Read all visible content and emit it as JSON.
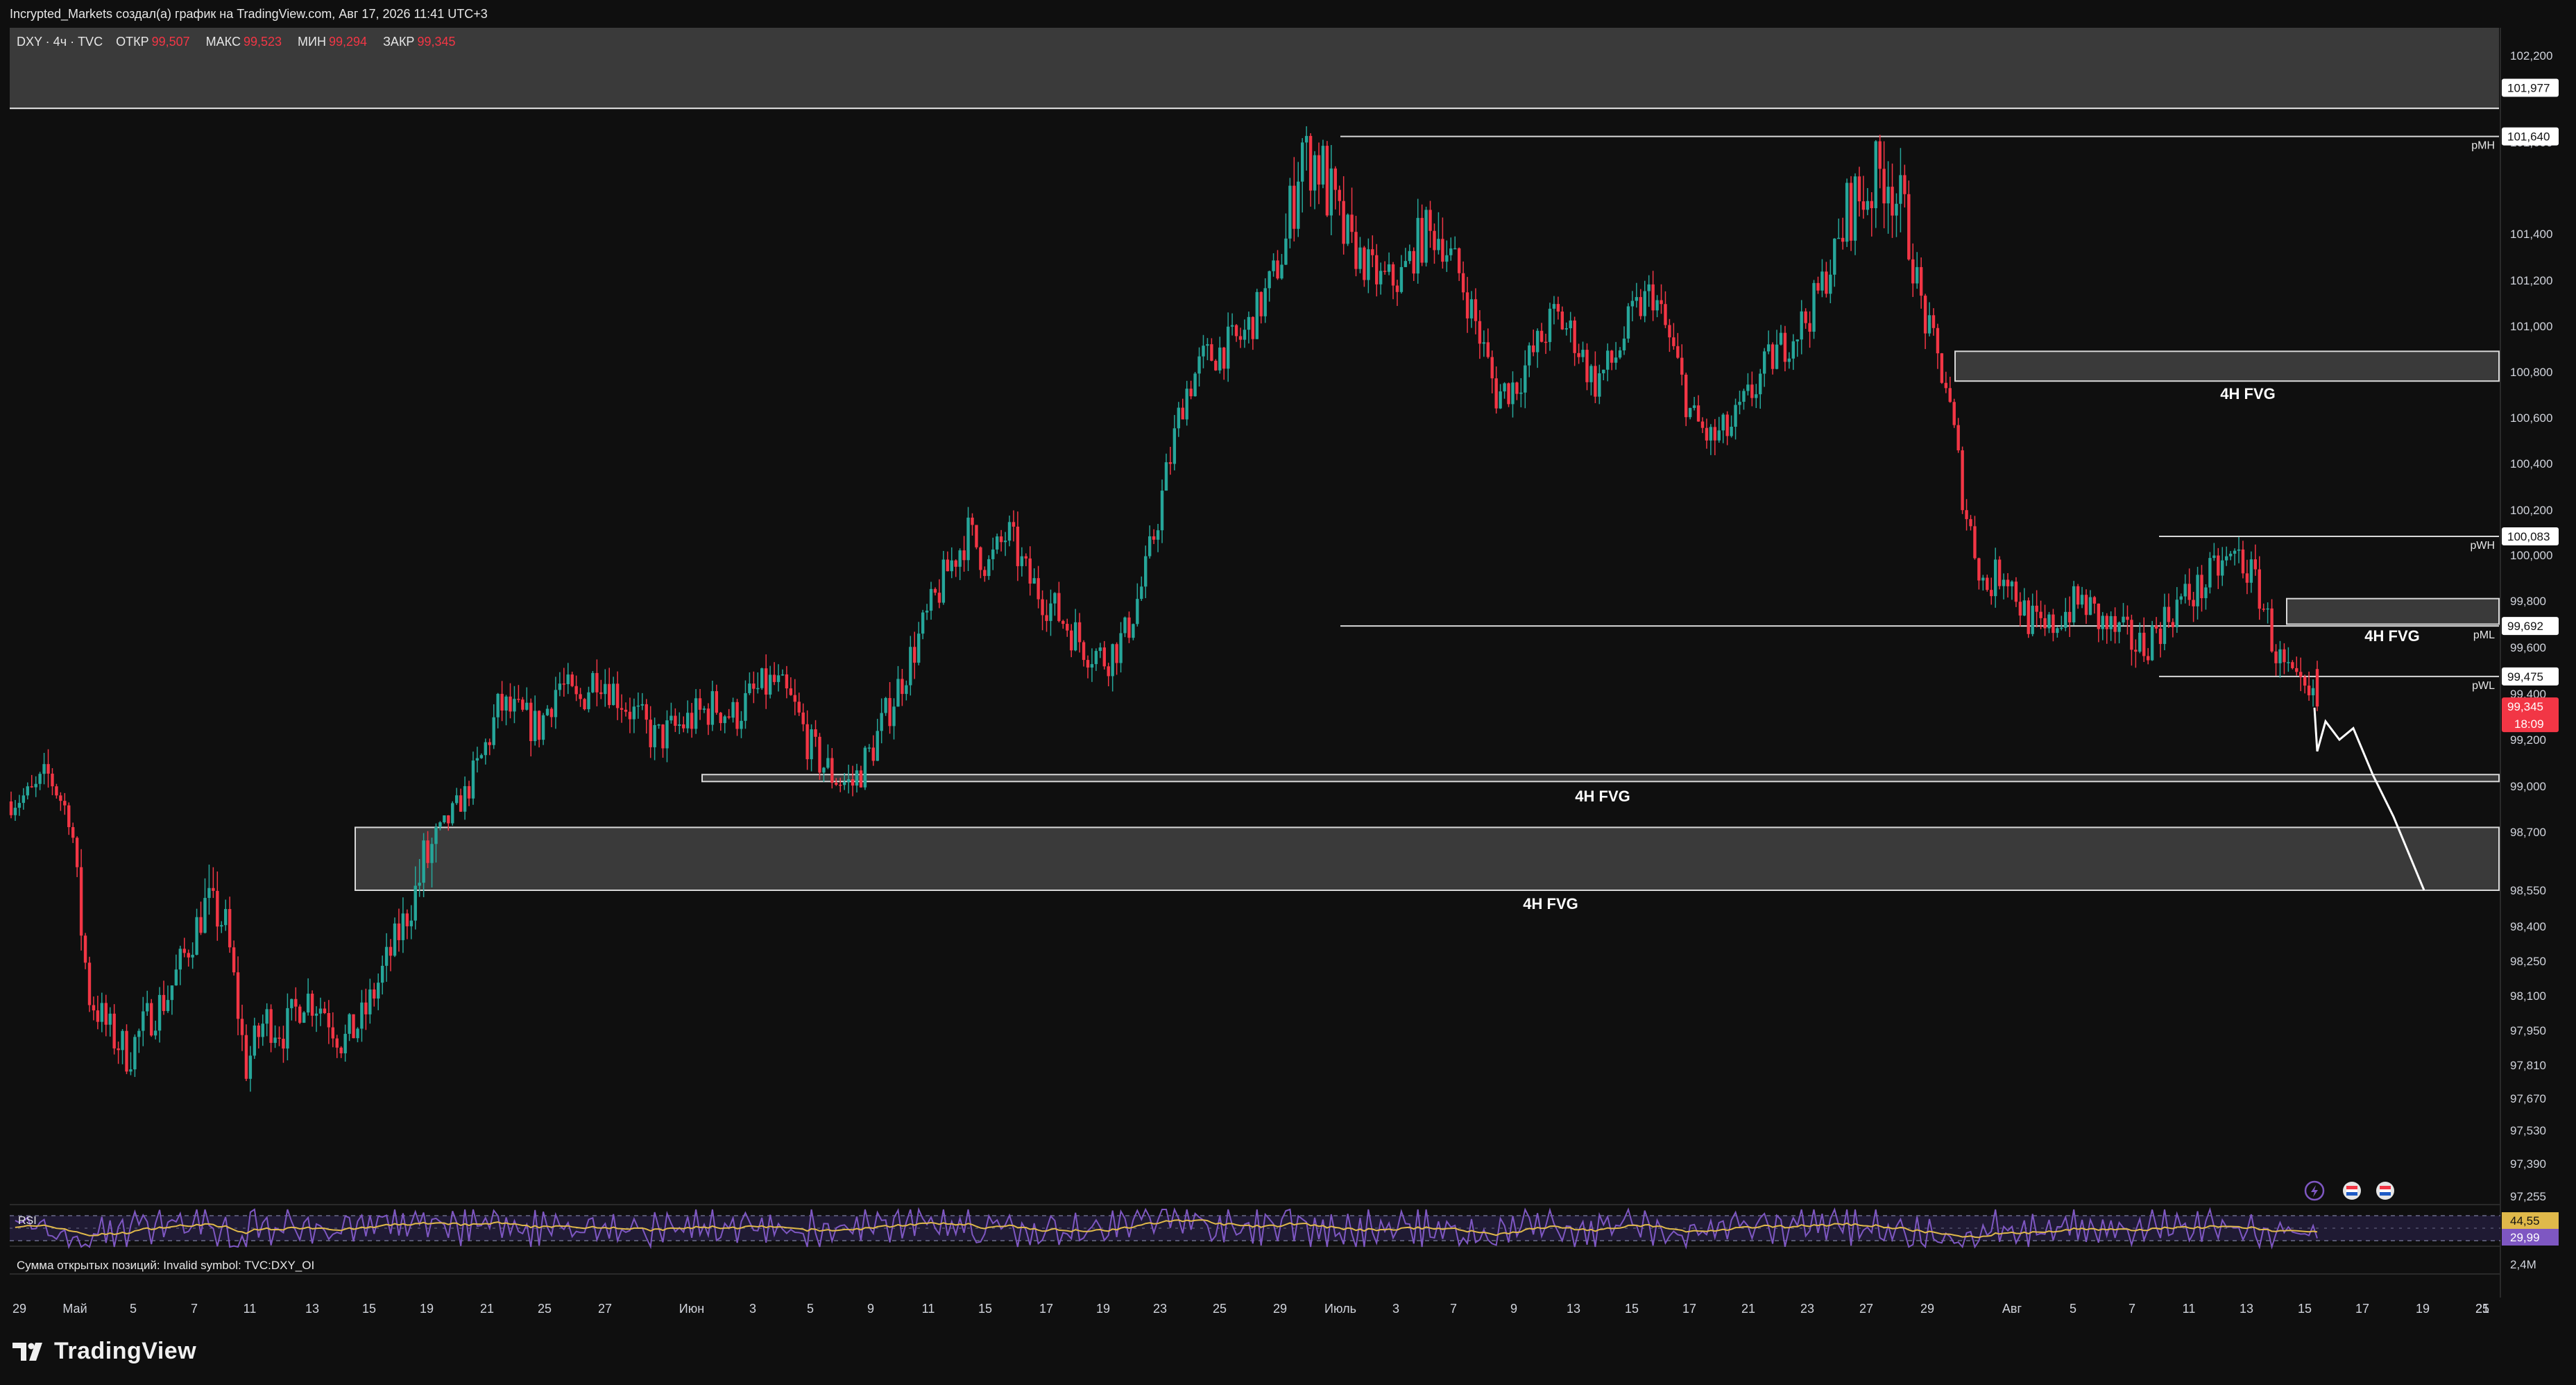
{
  "header": {
    "author_line": "Incrypted_Markets создал(а) график на TradingView.com, Авг 17, 2026 11:41 UTC+3"
  },
  "legend": {
    "symbol": "DXY · 4ч · TVC",
    "open_label": "ОТКР",
    "open_value": "99,507",
    "high_label": "МАКС",
    "high_value": "99,523",
    "low_label": "МИН",
    "low_value": "99,294",
    "close_label": "ЗАКР",
    "close_value": "99,345"
  },
  "colors": {
    "background": "#0f0f0f",
    "up_candle": "#26a69a",
    "down_candle": "#f23645",
    "zone_fill": "#3a3a3a",
    "level_line": "#d9d9d9",
    "projection": "#ffffff",
    "rsi_line": "#7e57c2",
    "rsi_ma": "#e0b94a"
  },
  "price_axis": {
    "ticks": [
      "102,200",
      "101,600",
      "101,400",
      "101,200",
      "101,000",
      "100,800",
      "100,600",
      "100,400",
      "100,200",
      "100,000",
      "99,800",
      "99,600",
      "99,400",
      "99,200",
      "99,000",
      "98,700",
      "98,550",
      "98,400",
      "98,250",
      "98,100",
      "97,950",
      "97,810",
      "97,670",
      "97,530",
      "97,390",
      "97,255"
    ],
    "tick_values": [
      102.2,
      101.6,
      101.4,
      101.2,
      101.0,
      100.8,
      100.6,
      100.4,
      100.2,
      100.0,
      99.8,
      99.6,
      99.4,
      99.2,
      99.0,
      98.7,
      98.55,
      98.4,
      98.25,
      98.1,
      97.95,
      97.81,
      97.67,
      97.53,
      97.39,
      97.255
    ],
    "price_labels": [
      {
        "text": "101,977",
        "value": 101.977,
        "style": "white"
      },
      {
        "text": "101,640",
        "value": 101.64,
        "style": "white"
      },
      {
        "text": "100,083",
        "value": 100.083,
        "style": "white"
      },
      {
        "text": "99,692",
        "value": 99.692,
        "style": "white"
      },
      {
        "text": "99,475",
        "value": 99.475,
        "style": "white"
      },
      {
        "text": "99,345",
        "value": 99.345,
        "style": "red"
      }
    ],
    "countdown": "18:09"
  },
  "time_axis": {
    "labels": [
      "29",
      "Май",
      "5",
      "7",
      "11",
      "13",
      "15",
      "19",
      "21",
      "25",
      "27",
      "Июн",
      "3",
      "5",
      "9",
      "11",
      "15",
      "17",
      "19",
      "23",
      "25",
      "29",
      "Июль",
      "3",
      "7",
      "9",
      "13",
      "15",
      "17",
      "21",
      "23",
      "27",
      "29",
      "Авг",
      "5",
      "7",
      "11",
      "13",
      "15",
      "17",
      "19",
      "21",
      "25"
    ]
  },
  "levels": [
    {
      "text": "pMH",
      "value": 101.64
    },
    {
      "text": "pWH",
      "value": 100.083
    },
    {
      "text": "pML",
      "value": 99.692
    },
    {
      "text": "pWL",
      "value": 99.475
    }
  ],
  "fvg_zones": [
    {
      "label": "4H FVG",
      "top": 100.89,
      "bottom": 100.76
    },
    {
      "label": "4H FVG",
      "top": 99.81,
      "bottom": 99.7
    },
    {
      "label": "4H FVG",
      "top": 99.05,
      "bottom": 99.02
    },
    {
      "label": "4H FVG",
      "top": 98.73,
      "bottom": 98.55
    }
  ],
  "chart_data": {
    "type": "candlestick",
    "symbol": "DXY",
    "timeframe": "4ч",
    "ylim": [
      97.255,
      102.2
    ],
    "x_range_labels": [
      "29",
      "25"
    ],
    "path_closes": [
      98.9,
      98.95,
      99.05,
      98.8,
      98.1,
      97.95,
      97.85,
      98.0,
      98.1,
      98.3,
      98.5,
      98.4,
      97.8,
      98.0,
      97.95,
      98.1,
      98.05,
      97.9,
      98.0,
      98.2,
      98.4,
      98.6,
      98.7,
      98.9,
      99.1,
      99.35,
      99.3,
      99.25,
      99.45,
      99.35,
      99.5,
      99.4,
      99.3,
      99.2,
      99.25,
      99.3,
      99.35,
      99.3,
      99.4,
      99.45,
      99.35,
      99.15,
      99.05,
      99.0,
      99.15,
      99.35,
      99.55,
      99.75,
      99.95,
      100.1,
      99.95,
      100.1,
      99.9,
      99.8,
      99.7,
      99.6,
      99.55,
      99.65,
      99.9,
      100.3,
      100.7,
      100.85,
      100.9,
      100.95,
      101.1,
      101.3,
      101.6,
      101.55,
      101.4,
      101.3,
      101.2,
      101.2,
      101.35,
      101.4,
      101.25,
      101.0,
      100.7,
      100.75,
      100.9,
      101.05,
      100.95,
      100.75,
      100.85,
      101.05,
      101.15,
      100.9,
      100.6,
      100.5,
      100.55,
      100.7,
      100.85,
      100.95,
      101.05,
      101.25,
      101.45,
      101.5,
      101.55,
      101.4,
      101.0,
      100.75,
      100.2,
      99.85,
      99.95,
      99.75,
      99.65,
      99.75,
      99.8,
      99.7,
      99.65,
      99.6,
      99.7,
      99.8,
      99.85,
      99.95,
      100.0,
      99.85,
      99.55,
      99.4,
      99.34
    ],
    "projection_path": [
      99.34,
      99.15,
      99.28,
      99.2,
      99.25,
      99.05,
      98.8,
      98.55
    ],
    "rsi": {
      "label": "RSI",
      "value": "44,55",
      "ma_value": "29,99",
      "levels": [
        70,
        50,
        30
      ]
    },
    "open_interest": {
      "label": "Сумма открытых позиций: Invalid symbol: TVC:DXY_OI",
      "axis_value": "2,4M"
    }
  },
  "toolbar_icons": [
    "lightning-icon",
    "flag-icon",
    "flag-icon"
  ]
}
